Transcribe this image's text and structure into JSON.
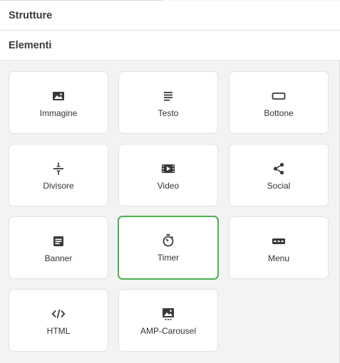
{
  "sections": [
    {
      "title": "Strutture"
    },
    {
      "title": "Elementi"
    }
  ],
  "colors": {
    "icon": "#3a3a3a",
    "selected_border": "#4caf50"
  },
  "elements": [
    {
      "label": "Immagine",
      "icon": "image-icon"
    },
    {
      "label": "Testo",
      "icon": "text-icon"
    },
    {
      "label": "Bottone",
      "icon": "button-icon"
    },
    {
      "label": "Divisore",
      "icon": "divider-icon"
    },
    {
      "label": "Video",
      "icon": "video-icon"
    },
    {
      "label": "Social",
      "icon": "share-icon"
    },
    {
      "label": "Banner",
      "icon": "banner-icon"
    },
    {
      "label": "Timer",
      "icon": "timer-icon",
      "selected": true
    },
    {
      "label": "Menu",
      "icon": "menu-icon"
    },
    {
      "label": "HTML",
      "icon": "code-icon"
    },
    {
      "label": "AMP-Carousel",
      "icon": "carousel-icon"
    }
  ]
}
